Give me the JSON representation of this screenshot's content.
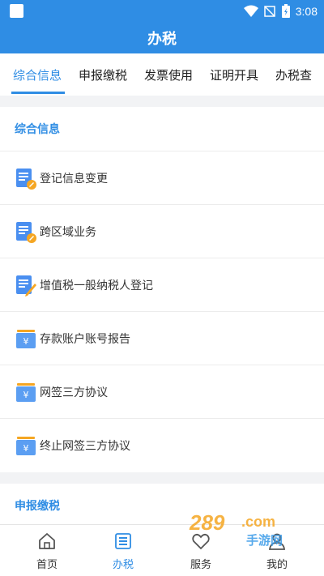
{
  "status_bar": {
    "time": "3:08"
  },
  "header": {
    "title": "办税"
  },
  "tabs": [
    {
      "label": "综合信息",
      "active": true
    },
    {
      "label": "申报缴税"
    },
    {
      "label": "发票使用"
    },
    {
      "label": "证明开具"
    },
    {
      "label": "办税查"
    }
  ],
  "sections": [
    {
      "title": "综合信息",
      "items": [
        {
          "label": "登记信息变更",
          "icon": "document-edit-icon"
        },
        {
          "label": "跨区域业务",
          "icon": "document-edit-icon"
        },
        {
          "label": "增值税一般纳税人登记",
          "icon": "document-pen-icon"
        },
        {
          "label": "存款账户账号报告",
          "icon": "yuan-card-icon"
        },
        {
          "label": "网签三方协议",
          "icon": "yuan-card-icon"
        },
        {
          "label": "终止网签三方协议",
          "icon": "yuan-card-icon"
        }
      ]
    },
    {
      "title": "申报缴税"
    }
  ],
  "bottom_nav": [
    {
      "label": "首页",
      "icon": "home-icon"
    },
    {
      "label": "办税",
      "icon": "list-icon",
      "active": true
    },
    {
      "label": "服务",
      "icon": "service-icon"
    },
    {
      "label": "我的",
      "icon": "profile-icon"
    }
  ],
  "watermark": {
    "number": "289",
    "suffix": ".com",
    "text": "手游网"
  },
  "colors": {
    "primary": "#2f8de4",
    "background": "#f2f3f5",
    "icon_orange": "#f5a623"
  }
}
